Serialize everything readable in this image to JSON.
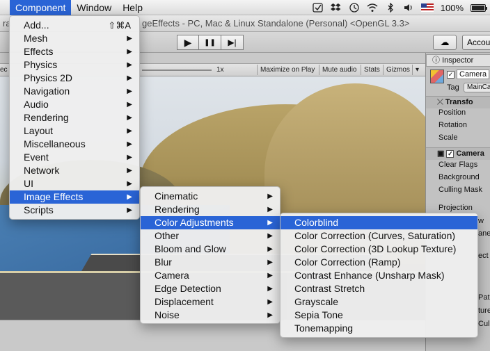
{
  "menubar": {
    "apple": "",
    "items": [
      "Component",
      "Window",
      "Help"
    ],
    "battery": "100%"
  },
  "window": {
    "title_prefix": "ra",
    "title": "geEffects - PC, Mac & Linux Standalone (Personal) <OpenGL 3.3>"
  },
  "toolbar": {
    "play": "▶",
    "pause": "❚❚",
    "step": "▶|",
    "cloud": "☁",
    "account": "Accou"
  },
  "game_view": {
    "aspect_stub": "ec",
    "scale": "1x",
    "maximize": "Maximize on Play",
    "mute": "Mute audio",
    "stats": "Stats",
    "gizmos": "Gizmos"
  },
  "inspector": {
    "tab": "Inspector",
    "object_name": "Camera",
    "tag_label": "Tag",
    "tag_value": "MainCa",
    "transform_header": "Transfo",
    "transform_rows": [
      "Position",
      "Rotation",
      "Scale"
    ],
    "camera_header": "Camera",
    "camera_rows": [
      "Clear Flags",
      "Background",
      "Culling Mask"
    ],
    "projection": "Projection",
    "partial": [
      "w",
      "ane",
      "ect",
      "Pat",
      "ture",
      "Cul"
    ]
  },
  "component_menu": {
    "items": [
      {
        "label": "Add...",
        "shortcut": "⇧⌘A"
      },
      {
        "label": "Mesh",
        "arrow": "▶"
      },
      {
        "label": "Effects",
        "arrow": "▶"
      },
      {
        "label": "Physics",
        "arrow": "▶"
      },
      {
        "label": "Physics 2D",
        "arrow": "▶"
      },
      {
        "label": "Navigation",
        "arrow": "▶"
      },
      {
        "label": "Audio",
        "arrow": "▶"
      },
      {
        "label": "Rendering",
        "arrow": "▶"
      },
      {
        "label": "Layout",
        "arrow": "▶"
      },
      {
        "label": "Miscellaneous",
        "arrow": "▶"
      },
      {
        "label": "Event",
        "arrow": "▶"
      },
      {
        "label": "Network",
        "arrow": "▶"
      },
      {
        "label": "UI",
        "arrow": "▶"
      },
      {
        "label": "Image Effects",
        "arrow": "▶"
      },
      {
        "label": "Scripts",
        "arrow": "▶"
      }
    ]
  },
  "image_effects_menu": {
    "items": [
      "Cinematic",
      "Rendering",
      "Color Adjustments",
      "Other",
      "Bloom and Glow",
      "Blur",
      "Camera",
      "Edge Detection",
      "Displacement",
      "Noise"
    ],
    "arrow": "▶"
  },
  "color_adjustments_menu": {
    "items": [
      "Colorblind",
      "Color Correction (Curves, Saturation)",
      "Color Correction (3D Lookup Texture)",
      "Color Correction (Ramp)",
      "Contrast Enhance (Unsharp Mask)",
      "Contrast Stretch",
      "Grayscale",
      "Sepia Tone",
      "Tonemapping"
    ]
  },
  "colors": {
    "highlight": "#2a64d6",
    "menu_bg": "#eeeeee"
  }
}
